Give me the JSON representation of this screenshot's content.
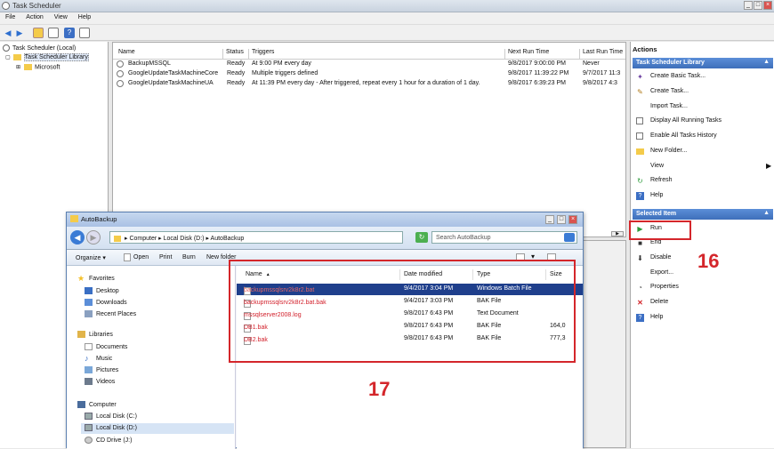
{
  "window": {
    "title": "Task Scheduler"
  },
  "menu": [
    "File",
    "Action",
    "View",
    "Help"
  ],
  "tree": {
    "root": "Task Scheduler (Local)",
    "library": "Task Scheduler Library",
    "child": "Microsoft"
  },
  "tasks": {
    "columns": [
      "Name",
      "Status",
      "Triggers",
      "Next Run Time",
      "Last Run Time"
    ],
    "rows": [
      {
        "name": "BackupMSSQL",
        "status": "Ready",
        "trigger": "At 9:00 PM every day",
        "next": "9/8/2017 9:00:00 PM",
        "last": "Never"
      },
      {
        "name": "GoogleUpdateTaskMachineCore",
        "status": "Ready",
        "trigger": "Multiple triggers defined",
        "next": "9/8/2017 11:39:22 PM",
        "last": "9/7/2017 11:3"
      },
      {
        "name": "GoogleUpdateTaskMachineUA",
        "status": "Ready",
        "trigger": "At 11:39 PM every day - After triggered, repeat every 1 hour for a duration of 1 day.",
        "next": "9/8/2017 6:39:23 PM",
        "last": "9/8/2017 4:3"
      }
    ]
  },
  "actions": {
    "title": "Actions",
    "library_section": "Task Scheduler Library",
    "library_items": [
      {
        "label": "Create Basic Task...",
        "icon": "wand-icon"
      },
      {
        "label": "Create Task...",
        "icon": "task-icon"
      },
      {
        "label": "Import Task...",
        "icon": ""
      },
      {
        "label": "Display All Running Tasks",
        "icon": "list-icon"
      },
      {
        "label": "Enable All Tasks History",
        "icon": "history-icon"
      },
      {
        "label": "New Folder...",
        "icon": "folder-icon"
      },
      {
        "label": "View",
        "icon": ""
      },
      {
        "label": "Refresh",
        "icon": "refresh-icon"
      },
      {
        "label": "Help",
        "icon": "help-icon"
      }
    ],
    "selected_section": "Selected Item",
    "selected_items": [
      {
        "label": "Run",
        "icon": "run-icon"
      },
      {
        "label": "End",
        "icon": "end-icon"
      },
      {
        "label": "Disable",
        "icon": "disable-icon"
      },
      {
        "label": "Export...",
        "icon": ""
      },
      {
        "label": "Properties",
        "icon": "properties-icon"
      },
      {
        "label": "Delete",
        "icon": "delete-icon"
      },
      {
        "label": "Help",
        "icon": "help-icon"
      }
    ]
  },
  "explorer": {
    "title": "AutoBackup",
    "breadcrumb": [
      "Computer",
      "Local Disk (D:)",
      "AutoBackup"
    ],
    "search_placeholder": "Search AutoBackup",
    "commands": [
      "Organize ▾",
      "Open",
      "Print",
      "Burn",
      "New folder"
    ],
    "nav": {
      "favorites": "Favorites",
      "fav_items": [
        "Desktop",
        "Downloads",
        "Recent Places"
      ],
      "libraries": "Libraries",
      "lib_items": [
        "Documents",
        "Music",
        "Pictures",
        "Videos"
      ],
      "computer": "Computer",
      "drives": [
        "Local Disk (C:)",
        "Local Disk (D:)",
        "CD Drive (J:)"
      ]
    },
    "columns": [
      "Name",
      "Date modified",
      "Type",
      "Size"
    ],
    "files": [
      {
        "name": "backupmssqlsrv2k8r2.bat",
        "date": "9/4/2017 3:04 PM",
        "type": "Windows Batch File",
        "size": "",
        "selected": true
      },
      {
        "name": "backupmssqlsrv2k8r2.bat.bak",
        "date": "9/4/2017 3:03 PM",
        "type": "BAK File",
        "size": "",
        "selected": false
      },
      {
        "name": "mssqlserver2008.log",
        "date": "9/8/2017 6:43 PM",
        "type": "Text Document",
        "size": "",
        "selected": false
      },
      {
        "name": "DB1.bak",
        "date": "9/8/2017 6:43 PM",
        "type": "BAK File",
        "size": "164,0",
        "selected": false
      },
      {
        "name": "DB2.bak",
        "date": "9/8/2017 6:43 PM",
        "type": "BAK File",
        "size": "777,3",
        "selected": false
      }
    ]
  },
  "annotations": {
    "run_step": "16",
    "files_step": "17"
  },
  "colors": {
    "annotation_red": "#d4262b",
    "section_blue": "#3e6fba",
    "selection_blue": "#1f3f8c"
  }
}
